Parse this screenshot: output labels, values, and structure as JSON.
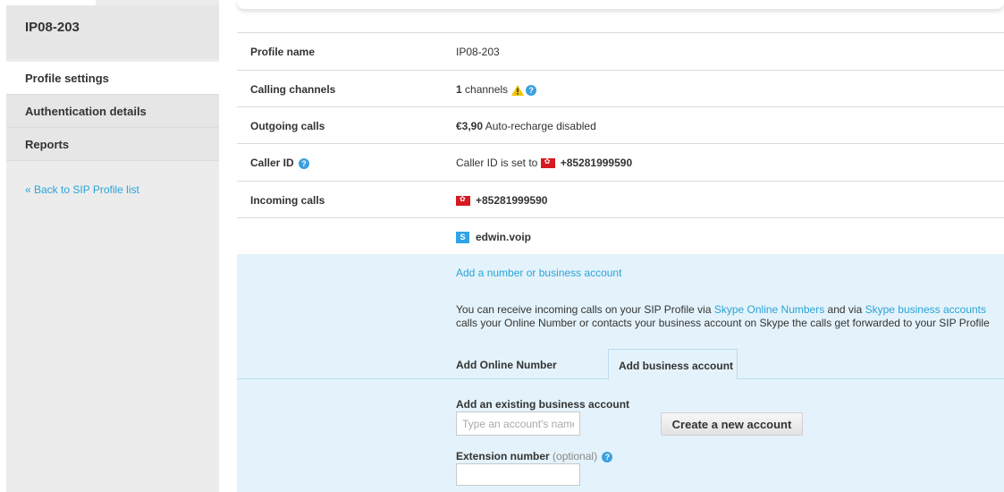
{
  "sidebar": {
    "title": "IP08-203",
    "items": [
      {
        "label": "Profile settings"
      },
      {
        "label": "Authentication details"
      },
      {
        "label": "Reports"
      }
    ],
    "back_link": "« Back to SIP Profile list"
  },
  "profile": {
    "profile_name": {
      "label": "Profile name",
      "value": "IP08-203"
    },
    "calling_channels": {
      "label": "Calling channels",
      "count": "1",
      "suffix": " channels"
    },
    "outgoing_calls": {
      "label": "Outgoing calls",
      "amount": "€3,90",
      "status": " Auto-recharge disabled"
    },
    "caller_id": {
      "label": "Caller ID",
      "prefix": "Caller ID is set to",
      "number": "+85281999590"
    },
    "incoming_calls": {
      "label": "Incoming calls",
      "number": "+85281999590",
      "skype_account": "edwin.voip"
    }
  },
  "add_section": {
    "link": "Add a number or business account",
    "desc_line1_a": "You can receive incoming calls on your SIP Profile via ",
    "desc_link1": "Skype Online Numbers",
    "desc_line1_b": " and via ",
    "desc_link2": "Skype business accounts",
    "desc_line2": "calls your Online Number or contacts your business account on Skype the calls get forwarded to your SIP Profile",
    "tabs": {
      "online": "Add Online Number",
      "business": "Add business account"
    },
    "existing_title": "Add an existing business account",
    "account_placeholder": "Type an account's name",
    "create_button": "Create a new account",
    "extension_label": "Extension number",
    "extension_optional": "(optional)"
  },
  "colors": {
    "link": "#2aa3d9",
    "panel": "#e4f3fb",
    "sidebar": "#ececec"
  }
}
